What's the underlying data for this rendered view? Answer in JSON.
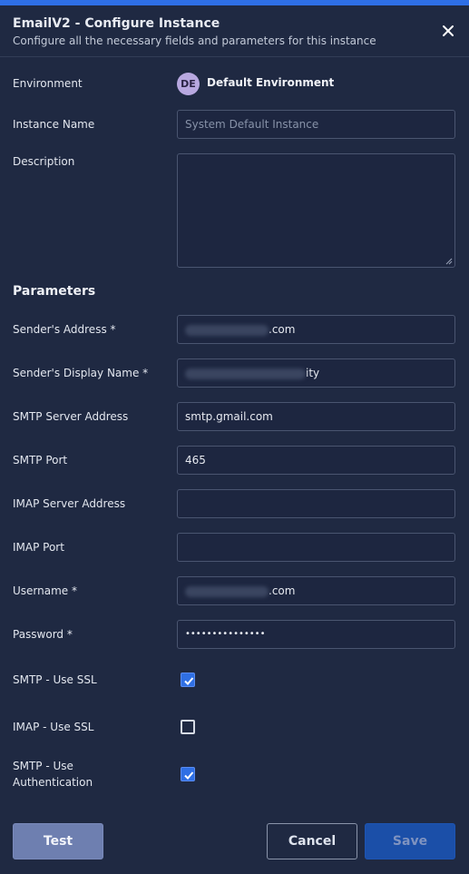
{
  "dialog": {
    "title": "EmailV2 - Configure Instance",
    "subtitle": "Configure all the necessary fields and parameters for this instance",
    "close_icon": "close-icon"
  },
  "general": {
    "environment_label": "Environment",
    "environment_initials": "DE",
    "environment_name": "Default Environment",
    "instance_name_label": "Instance Name",
    "instance_name_placeholder": "System Default Instance",
    "description_label": "Description",
    "description_value": ""
  },
  "parameters": {
    "heading": "Parameters",
    "senders_address_label": "Sender's Address *",
    "senders_address_suffix": ".com",
    "senders_display_name_label": "Sender's Display Name *",
    "senders_display_name_suffix": "ity",
    "smtp_server_label": "SMTP Server Address",
    "smtp_server_value": "smtp.gmail.com",
    "smtp_port_label": "SMTP Port",
    "smtp_port_value": "465",
    "imap_server_label": "IMAP Server Address",
    "imap_server_value": "",
    "imap_port_label": "IMAP Port",
    "imap_port_value": "",
    "username_label": "Username *",
    "username_suffix": ".com",
    "password_label": "Password *",
    "password_value": "•••••••••••••••",
    "smtp_ssl_label": "SMTP - Use SSL",
    "smtp_ssl_checked": true,
    "imap_ssl_label": "IMAP - Use SSL",
    "imap_ssl_checked": false,
    "smtp_auth_label_line1": "SMTP - Use",
    "smtp_auth_label_line2": "Authentication",
    "smtp_auth_checked": true
  },
  "footer": {
    "test_label": "Test",
    "cancel_label": "Cancel",
    "save_label": "Save"
  },
  "colors": {
    "background": "#1f2942",
    "accent": "#2e6fe6",
    "checkbox_on": "#2f6fe4",
    "test_button": "#6e7fb0",
    "save_button": "#1b4fa8"
  }
}
